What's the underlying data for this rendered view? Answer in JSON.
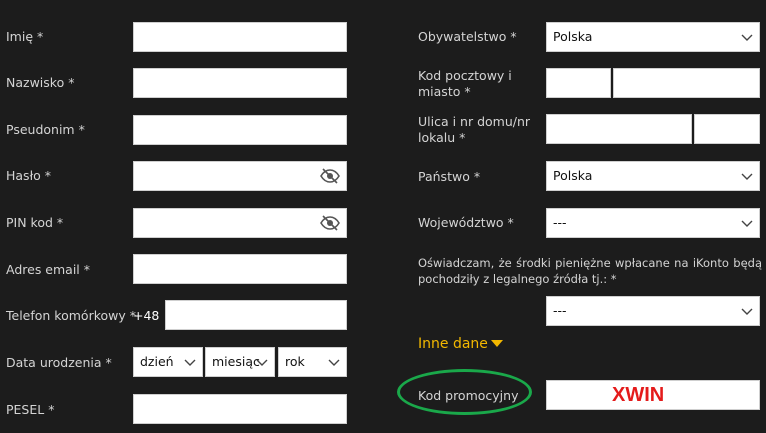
{
  "left": {
    "first_name": {
      "label": "Imię *",
      "value": ""
    },
    "last_name": {
      "label": "Nazwisko *",
      "value": ""
    },
    "nickname": {
      "label": "Pseudonim *",
      "value": ""
    },
    "password": {
      "label": "Hasło *",
      "icon": "eye-slash-icon"
    },
    "pin": {
      "label": "PIN kod *",
      "icon": "eye-slash-icon"
    },
    "email": {
      "label": "Adres email *",
      "value": ""
    },
    "phone": {
      "label": "Telefon komórkowy *",
      "prefix": "+48",
      "value": ""
    },
    "birth": {
      "label": "Data urodzenia *",
      "day": "dzień",
      "month": "miesiąc",
      "year": "rok"
    },
    "pesel": {
      "label": "PESEL *",
      "value": ""
    }
  },
  "right": {
    "citizenship": {
      "label": "Obywatelstwo *",
      "value": "Polska"
    },
    "postal": {
      "label_line1": "Kod pocztowy i",
      "label_line2": "miasto *"
    },
    "street": {
      "label_line1": "Ulica i nr domu/nr",
      "label_line2": "lokalu *"
    },
    "country": {
      "label": "Państwo *",
      "value": "Polska"
    },
    "province": {
      "label": "Województwo *",
      "value": "---"
    },
    "declaration": {
      "line1": "Oświadczam, że środki pieniężne wpłacane na iKonto będą",
      "line2": "pochodziły z legalnego źródła tj.: *",
      "value": "---"
    },
    "other_section": {
      "label": "Inne dane"
    },
    "promo": {
      "label": "Kod promocyjny",
      "value": "XWIN"
    }
  },
  "colors": {
    "accent": "#f3b800",
    "promo": "#e41b1b",
    "highlight": "#1aa84a",
    "background": "#1c1c1c"
  }
}
